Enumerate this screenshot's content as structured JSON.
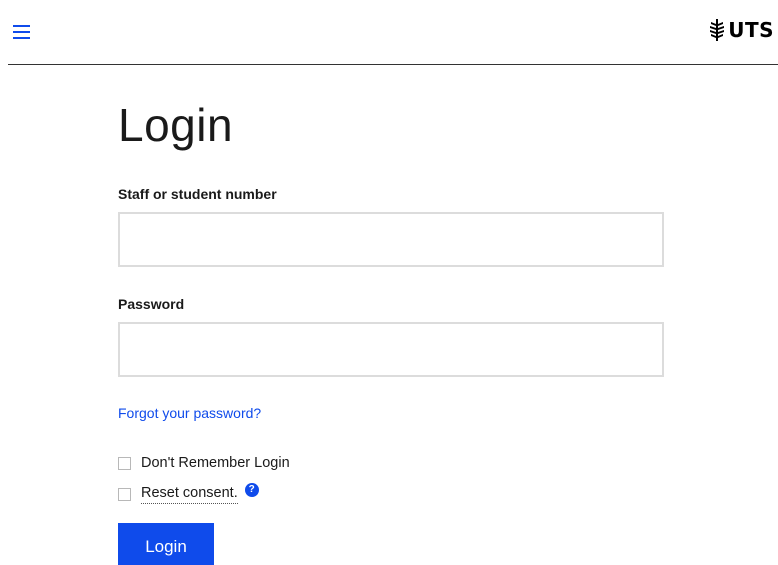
{
  "header": {
    "menu_icon": "hamburger-menu-icon",
    "logo_text": "UTS",
    "logo_icon": "uts-crest-icon"
  },
  "form": {
    "title": "Login",
    "username_label": "Staff or student number",
    "username_value": "",
    "password_label": "Password",
    "password_value": "",
    "forgot_link": "Forgot your password?",
    "remember_label": "Don't Remember Login",
    "remember_checked": false,
    "consent_label": "Reset consent.",
    "consent_checked": false,
    "help_icon": "?",
    "submit_label": "Login"
  },
  "colors": {
    "accent": "#0f4beb",
    "text": "#1a1a1a",
    "input_border": "#dcdcdc"
  }
}
